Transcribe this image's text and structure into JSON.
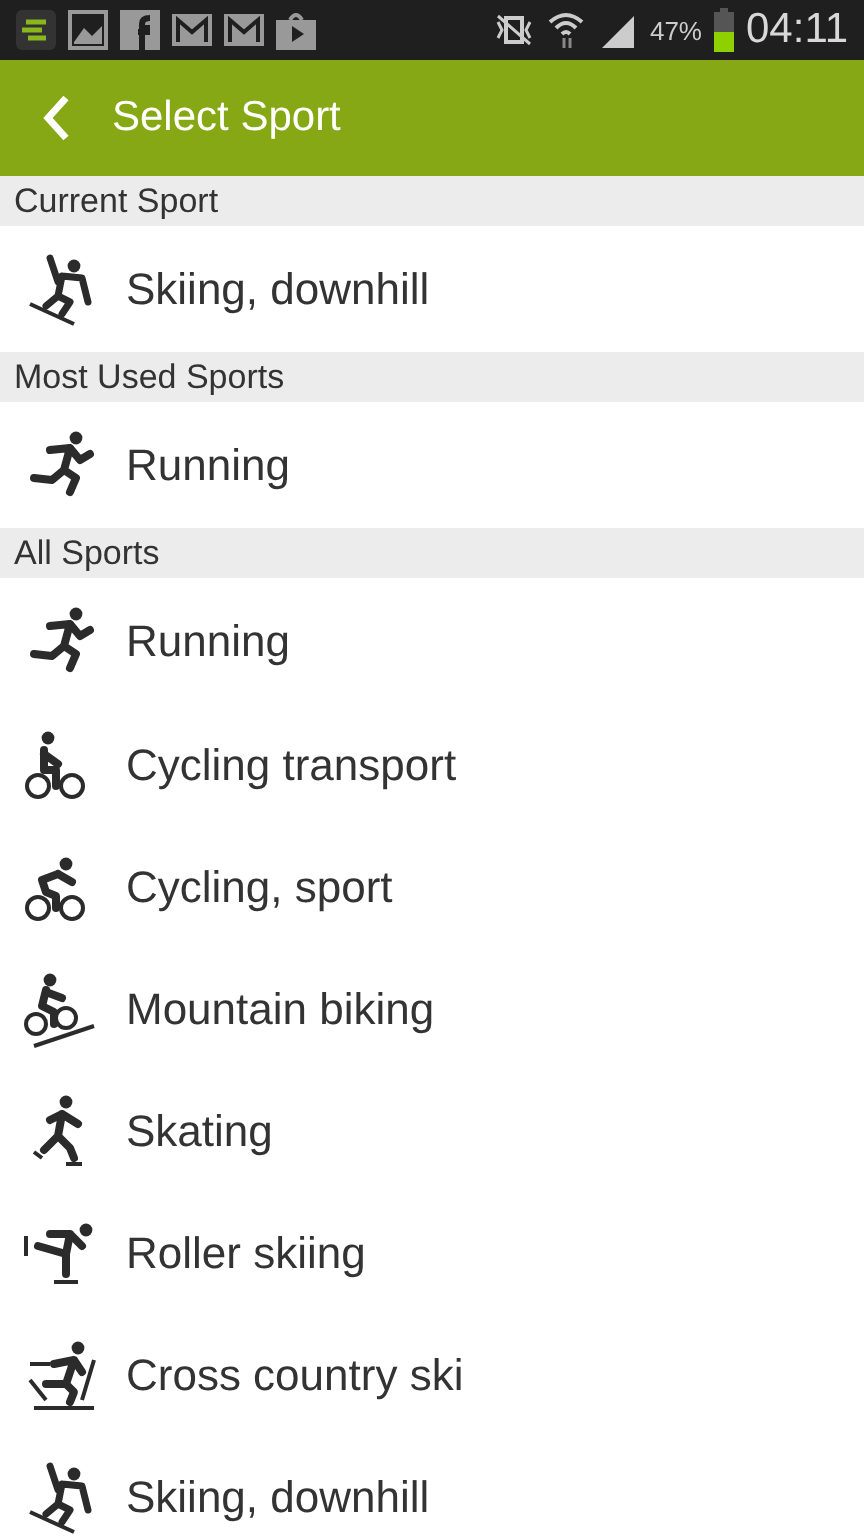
{
  "status_bar": {
    "battery": "47%",
    "time": "04:11"
  },
  "header": {
    "title": "Select Sport"
  },
  "sections": [
    {
      "title": "Current Sport",
      "items": [
        {
          "label": "Skiing, downhill",
          "kind": "downhill"
        }
      ]
    },
    {
      "title": "Most Used Sports",
      "items": [
        {
          "label": "Running",
          "kind": "running"
        }
      ]
    },
    {
      "title": "All Sports",
      "items": [
        {
          "label": "Running",
          "kind": "running"
        },
        {
          "label": "Cycling transport",
          "kind": "cycling"
        },
        {
          "label": "Cycling, sport",
          "kind": "cyclingsport"
        },
        {
          "label": "Mountain biking",
          "kind": "mtb"
        },
        {
          "label": "Skating",
          "kind": "skating"
        },
        {
          "label": "Roller skiing",
          "kind": "rollerski"
        },
        {
          "label": "Cross country ski",
          "kind": "crosscountry"
        },
        {
          "label": "Skiing, downhill",
          "kind": "downhill"
        }
      ]
    }
  ]
}
